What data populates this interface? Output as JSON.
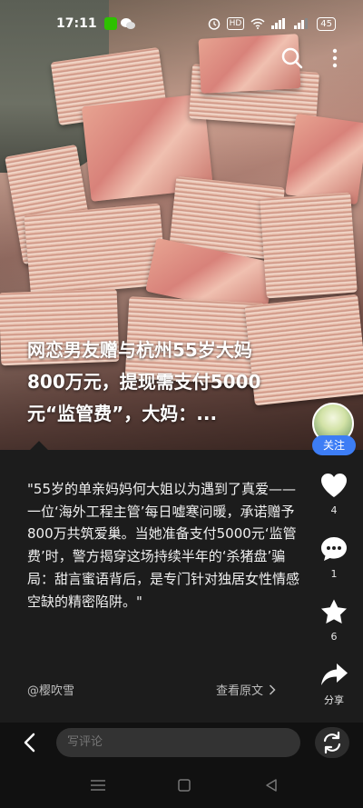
{
  "status_bar": {
    "time": "17:11",
    "hd": "HD",
    "network": "4G",
    "battery": "45"
  },
  "article": {
    "headline": "网恋男友赠与杭州55岁大妈800万元，提现需支付5000元“监管费”，大妈：...",
    "quote": "\"55岁的单亲妈妈何大姐以为遇到了真爱——一位‘海外工程主管’每日嘘寒问暖，承诺赠予800万共筑爱巢。当她准备支付5000元‘监管费’时，警方揭穿这场持续半年的‘杀猪盘’骗局：甜言蜜语背后，是专门针对独居女性情感空缺的精密陷阱。\"",
    "author": "@樱吹雪",
    "view_original": "查看原文"
  },
  "actions": {
    "follow": "关注",
    "like_count": "4",
    "comment_count": "1",
    "favorite_count": "6",
    "share_label": "分享"
  },
  "comment_bar": {
    "placeholder": "写评论"
  },
  "icons": {
    "search": "search-icon",
    "more": "more-vertical-icon",
    "like": "heart-icon",
    "comment": "comment-icon",
    "favorite": "star-icon",
    "share": "share-icon",
    "back": "chevron-left-icon",
    "refresh": "refresh-icon"
  },
  "colors": {
    "follow_button": "#3d7df5",
    "panel_bg": "#1c1c1c"
  }
}
